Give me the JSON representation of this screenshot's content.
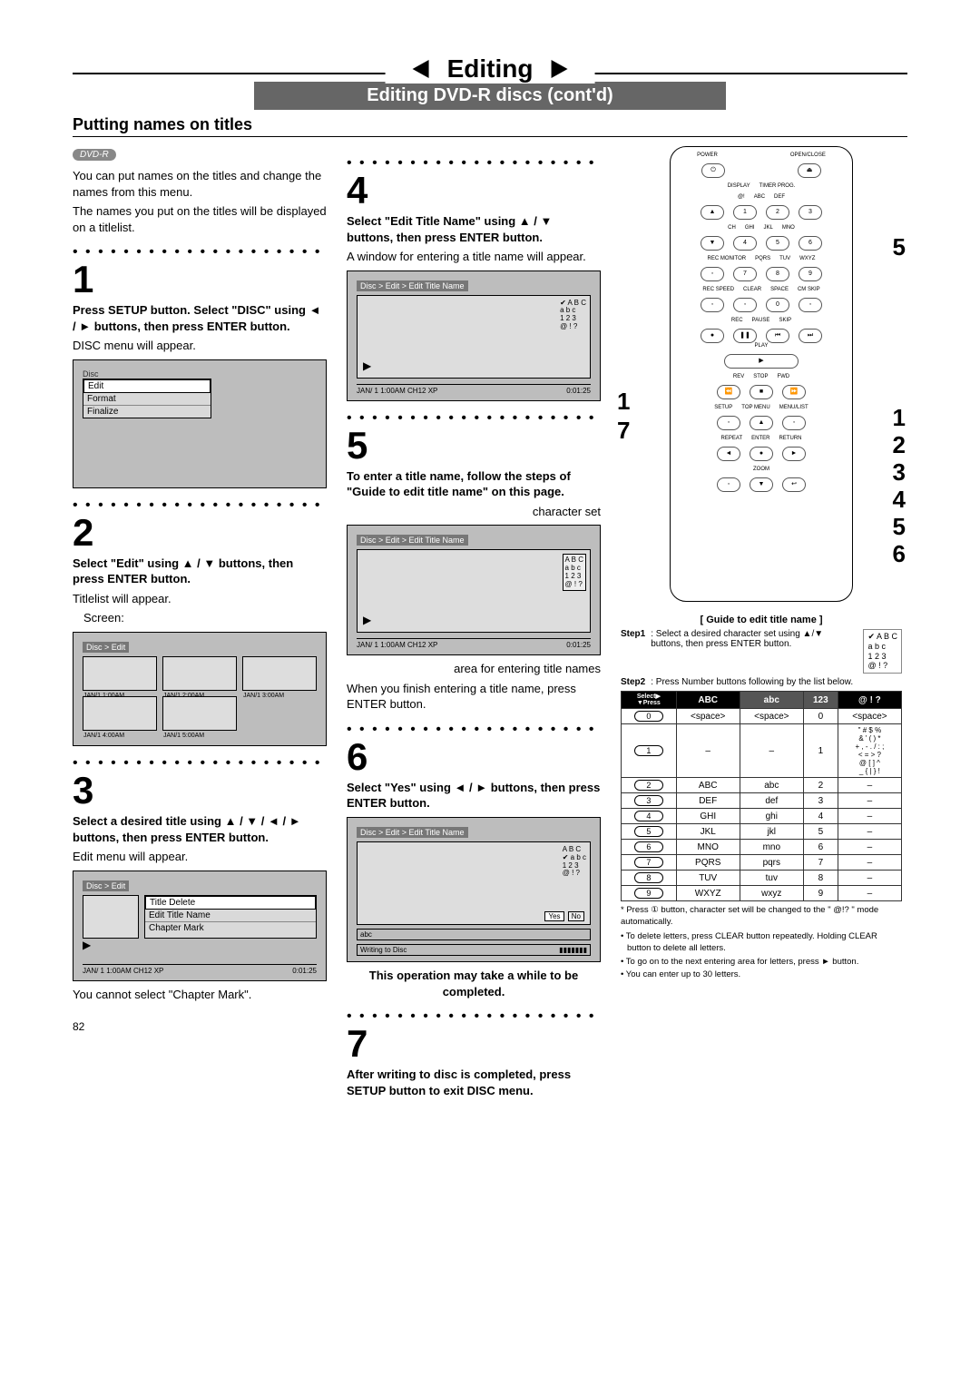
{
  "header": {
    "title": "Editing",
    "subtitle": "Editing DVD-R discs (cont'd)",
    "section": "Putting names on titles"
  },
  "dvd_badge": "DVD-R",
  "intro1": "You can put names on the titles and change the names from this menu.",
  "intro2": "The names you put on the titles will be displayed on a titlelist.",
  "step1": {
    "num": "1",
    "lead": "Press SETUP button. Select \"DISC\" using ◄ / ► buttons, then press ENTER button.",
    "after": "DISC menu will appear.",
    "screen_title": "Disc",
    "menu": [
      "Edit",
      "Format",
      "Finalize"
    ]
  },
  "step2": {
    "num": "2",
    "lead": "Select \"Edit\" using ▲ / ▼ buttons, then press ENTER button.",
    "after": "Titlelist will appear.",
    "screen_label": "Screen:",
    "bc": "Disc > Edit",
    "thumbs": [
      "JAN/1  1:00AM",
      "JAN/1  2:00AM",
      "JAN/1  3:00AM",
      "JAN/1  4:00AM",
      "JAN/1  5:00AM"
    ]
  },
  "step3": {
    "num": "3",
    "lead": "Select a desired title using ▲ / ▼ / ◄ / ► buttons, then press ENTER button.",
    "after": "Edit menu will appear.",
    "bc": "Disc > Edit",
    "menu": [
      "Title Delete",
      "Edit Title Name",
      "Chapter Mark"
    ],
    "footline_l": "JAN/ 1   1:00AM  CH12    XP",
    "footline_r": "0:01:25",
    "note": "You cannot select \"Chapter Mark\"."
  },
  "step4": {
    "num": "4",
    "lead": "Select \"Edit Title Name\" using ▲ / ▼ buttons, then press ENTER button.",
    "after": "A window for entering a title name will appear.",
    "bc": "Disc > Edit > Edit Title Name",
    "charset": [
      "A B C",
      "a b c",
      "1 2 3",
      "@ ! ?"
    ],
    "footline_l": "JAN/ 1   1:00AM  CH12   XP",
    "footline_r": "0:01:25"
  },
  "step5": {
    "num": "5",
    "lead": "To enter a title name, follow the steps of \"Guide to edit title name\" on this page.",
    "callout_top": "character set",
    "bc": "Disc > Edit > Edit Title Name",
    "charset": [
      "A B C",
      "a b c",
      "1 2 3",
      "@ ! ?"
    ],
    "footline_l": "JAN/ 1   1:00AM  CH12   XP",
    "footline_r": "0:01:25",
    "callout_bottom": "area for entering title names",
    "after": "When you finish entering a title name, press ENTER button."
  },
  "step6": {
    "num": "6",
    "lead": "Select \"Yes\" using ◄ / ► buttons, then press ENTER button.",
    "bc": "Disc > Edit > Edit Title Name",
    "charset": [
      "A B C",
      "a b c",
      "1 2 3",
      "@ ! ?"
    ],
    "input_value": "abc",
    "yes": "Yes",
    "no": "No",
    "writing": "Writing to Disc",
    "warn": "This operation may take a while to be completed."
  },
  "step7": {
    "num": "7",
    "lead": "After writing to disc is completed, press SETUP button to exit DISC menu."
  },
  "remote": {
    "labels": {
      "power": "POWER",
      "open": "OPEN/CLOSE",
      "display": "DISPLAY",
      "timer": "TIMER PROG.",
      "ch": "CH",
      "ghi": "GHI",
      "jkl": "JKL",
      "mno": "MNO",
      "rec_monitor": "REC MONITOR",
      "pqrs": "PQRS",
      "tuv": "TUV",
      "wxyz": "WXYZ",
      "rec_speed": "REC SPEED",
      "clear": "CLEAR",
      "space": "SPACE",
      "cmskip": "CM SKIP",
      "rec": "REC",
      "pause": "PAUSE",
      "skip": "SKIP",
      "play": "PLAY",
      "rev": "REV",
      "stop": "STOP",
      "fwd": "FWD",
      "setup": "SETUP",
      "topmenu": "TOP MENU",
      "menulist": "MENU/LIST",
      "repeat": "REPEAT",
      "enter": "ENTER",
      "return": "RETURN",
      "zoom": "ZOOM",
      "abc": "ABC",
      "def": "DEF",
      "at": "@!"
    },
    "callouts_left": [
      "1",
      "7"
    ],
    "callouts_right_top": "5",
    "callouts_right": [
      "1",
      "2",
      "3",
      "4",
      "5",
      "6"
    ]
  },
  "guide": {
    "title": "[ Guide to edit title name ]",
    "step1_label": "Step1",
    "step1_text": ": Select a desired character set using ▲/▼ buttons, then press ENTER button.",
    "step1_charset": [
      "A B C",
      "a b c",
      "1 2 3",
      "@ ! ?"
    ],
    "step2_label": "Step2",
    "step2_text": ": Press Number buttons following by the list below.",
    "table_corner": {
      "top": "Select",
      "bottom": "Press"
    },
    "table_headers": [
      "ABC",
      "abc",
      "123",
      "@ ! ?"
    ],
    "rows": [
      {
        "k": "0",
        "c": [
          "<space>",
          "<space>",
          "0",
          "<space>"
        ]
      },
      {
        "k": "1",
        "c": [
          "–",
          "–",
          "1",
          "\" # $ %\n& ' ( ) *\n+ , - . / : ;\n< = > ?\n@ [ ] ^\n_ { | } !"
        ]
      },
      {
        "k": "2",
        "c": [
          "ABC",
          "abc",
          "2",
          "–"
        ]
      },
      {
        "k": "3",
        "c": [
          "DEF",
          "def",
          "3",
          "–"
        ]
      },
      {
        "k": "4",
        "c": [
          "GHI",
          "ghi",
          "4",
          "–"
        ]
      },
      {
        "k": "5",
        "c": [
          "JKL",
          "jkl",
          "5",
          "–"
        ]
      },
      {
        "k": "6",
        "c": [
          "MNO",
          "mno",
          "6",
          "–"
        ]
      },
      {
        "k": "7",
        "c": [
          "PQRS",
          "pqrs",
          "7",
          "–"
        ]
      },
      {
        "k": "8",
        "c": [
          "TUV",
          "tuv",
          "8",
          "–"
        ]
      },
      {
        "k": "9",
        "c": [
          "WXYZ",
          "wxyz",
          "9",
          "–"
        ]
      }
    ],
    "footnote": "* Press ① button, character set will be changed to the \" @!? \" mode automatically.",
    "bullets": [
      "To delete letters, press CLEAR button repeatedly. Holding CLEAR button to delete all letters.",
      "To go on to the next entering area for letters, press ► button.",
      "You can enter up to 30 letters."
    ]
  },
  "page_no": "82"
}
